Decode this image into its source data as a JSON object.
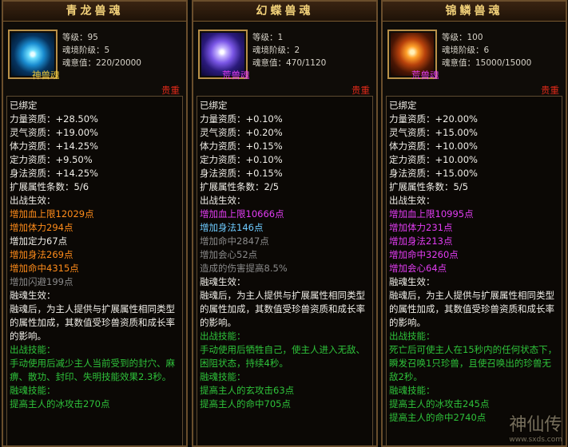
{
  "panels": [
    {
      "title": "青龙兽魂",
      "icon": "azure-dragon-soul-icon",
      "stats": [
        "等级：95",
        "魂境阶级：5",
        "魂意值：220/20000"
      ],
      "soul_type": "神兽魂",
      "rarity": "贵重",
      "lines": [
        {
          "t": "已绑定",
          "c": "w"
        },
        {
          "t": "力量资质：+28.50%",
          "c": "w"
        },
        {
          "t": "灵气资质：+19.00%",
          "c": "w"
        },
        {
          "t": "体力资质：+14.25%",
          "c": "w"
        },
        {
          "t": "定力资质：+9.50%",
          "c": "w"
        },
        {
          "t": "身法资质：+14.25%",
          "c": "w"
        },
        {
          "t": "扩展属性条数：5/6",
          "c": "w"
        },
        {
          "t": "出战生效：",
          "c": "w"
        },
        {
          "t": "增加血上限12029点",
          "c": "o"
        },
        {
          "t": "增加体力294点",
          "c": "o"
        },
        {
          "t": "增加定力67点",
          "c": "w"
        },
        {
          "t": "增加身法269点",
          "c": "o"
        },
        {
          "t": "增加命中4315点",
          "c": "o"
        },
        {
          "t": "增加闪避199点",
          "c": "g"
        },
        {
          "t": "融魂生效：",
          "c": "w"
        }
      ],
      "fuse_text": "融魂后，为主人提供与扩展属性相同类型的属性加成，其数值受珍兽资质和成长率的影响。",
      "battle_skill_title": "出战技能：",
      "battle_skill_text": "手动使用后减少主人当前受到的封穴、麻痹、散功、封印、失明技能效果2.3秒。",
      "fuse_skill_title": "融魂技能：",
      "fuse_skill_text": "提高主人的冰攻击270点"
    },
    {
      "title": "幻蝶兽魂",
      "icon": "phantom-butterfly-soul-icon",
      "stats": [
        "等级：1",
        "魂境阶级：2",
        "魂意值：470/1120"
      ],
      "soul_type": "荒兽魂",
      "rarity": "贵重",
      "lines": [
        {
          "t": "已绑定",
          "c": "w"
        },
        {
          "t": "力量资质：+0.10%",
          "c": "w"
        },
        {
          "t": "灵气资质：+0.20%",
          "c": "w"
        },
        {
          "t": "体力资质：+0.15%",
          "c": "w"
        },
        {
          "t": "定力资质：+0.10%",
          "c": "w"
        },
        {
          "t": "身法资质：+0.15%",
          "c": "w"
        },
        {
          "t": "扩展属性条数：2/5",
          "c": "w"
        },
        {
          "t": "出战生效：",
          "c": "w"
        },
        {
          "t": "增加血上限10666点",
          "c": "pu"
        },
        {
          "t": "增加身法146点",
          "c": "c"
        },
        {
          "t": "增加命中2847点",
          "c": "g"
        },
        {
          "t": "增加会心52点",
          "c": "g"
        },
        {
          "t": "造成的伤害提高8.5%",
          "c": "g"
        },
        {
          "t": "融魂生效：",
          "c": "w"
        }
      ],
      "fuse_text": "融魂后，为主人提供与扩展属性相同类型的属性加成，其数值受珍兽资质和成长率的影响。",
      "battle_skill_title": "出战技能：",
      "battle_skill_text": "手动使用后牺牲自己，使主人进入无敌、困阻状态，持续4秒。",
      "fuse_skill_title": "融魂技能：",
      "fuse_skill_text": "提高主人的玄攻击63点",
      "fuse_skill_text2": "提高主人的命中705点"
    },
    {
      "title": "锦鳞兽魂",
      "icon": "brocade-scale-soul-icon",
      "stats": [
        "等级：100",
        "魂境阶级：6",
        "魂意值：15000/15000"
      ],
      "soul_type": "荒兽魂",
      "rarity": "贵重",
      "lines": [
        {
          "t": "已绑定",
          "c": "w"
        },
        {
          "t": "力量资质：+20.00%",
          "c": "w"
        },
        {
          "t": "灵气资质：+15.00%",
          "c": "w"
        },
        {
          "t": "体力资质：+10.00%",
          "c": "w"
        },
        {
          "t": "定力资质：+10.00%",
          "c": "w"
        },
        {
          "t": "身法资质：+15.00%",
          "c": "w"
        },
        {
          "t": "扩展属性条数：5/5",
          "c": "w"
        },
        {
          "t": "出战生效：",
          "c": "w"
        },
        {
          "t": "增加血上限10995点",
          "c": "pu"
        },
        {
          "t": "增加体力231点",
          "c": "pu"
        },
        {
          "t": "增加身法213点",
          "c": "pu"
        },
        {
          "t": "增加命中3260点",
          "c": "pu"
        },
        {
          "t": "增加会心64点",
          "c": "pu"
        },
        {
          "t": "融魂生效：",
          "c": "w"
        }
      ],
      "fuse_text": "融魂后，为主人提供与扩展属性相同类型的属性加成，其数值受珍兽资质和成长率的影响。",
      "battle_skill_title": "出战技能：",
      "battle_skill_text": "死亡后可使主人在15秒内的任何状态下，瞬发召唤1只珍兽，且使召唤出的珍兽无敌2秒。",
      "fuse_skill_title": "融魂技能：",
      "fuse_skill_text": "提高主人的冰攻击245点",
      "fuse_skill_text2": "提高主人的命中2740点"
    }
  ],
  "watermark": {
    "text": "神仙传",
    "url": "www.sxds.com"
  }
}
